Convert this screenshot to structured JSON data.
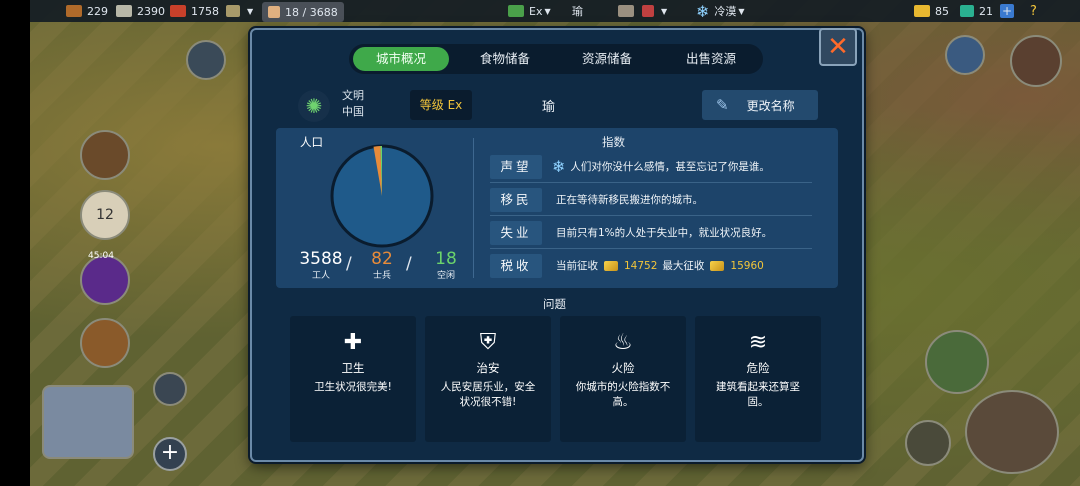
{
  "topbar": {
    "wood": "229",
    "iron": "2390",
    "food": "1758",
    "population": "18 / 3688",
    "era": "Ex",
    "city": "瑜",
    "season": "冷漠",
    "gold": "85",
    "gems": "21",
    "add_label": "+",
    "help_label": "?"
  },
  "tabs": [
    {
      "label": "城市概况",
      "active": true
    },
    {
      "label": "食物储备",
      "active": false
    },
    {
      "label": "资源储备",
      "active": false
    },
    {
      "label": "出售资源",
      "active": false
    }
  ],
  "close_label": "✕",
  "city": {
    "civ_label": "文明",
    "civ_value": "中国",
    "level_label": "等级 Ex",
    "name": "瑜",
    "rename_label": "更改名称"
  },
  "population": {
    "title": "人口",
    "workers": {
      "value": "3588",
      "label": "工人",
      "color": "#ffffff"
    },
    "soldiers": {
      "value": "82",
      "label": "士兵",
      "color": "#e78b3a"
    },
    "idle": {
      "value": "18",
      "label": "空闲",
      "color": "#6bd36b"
    }
  },
  "indices": {
    "title": "指数",
    "rows": [
      {
        "key": "声望",
        "text": "人们对你没什么感情，甚至忘记了你是谁。"
      },
      {
        "key": "移民",
        "text": "正在等待新移民搬进你的城市。"
      },
      {
        "key": "失业",
        "text": "目前只有1%的人处于失业中，就业状况良好。"
      },
      {
        "key": "税收",
        "text": "当前征收",
        "current": "14752",
        "max_label": "最大征收",
        "max": "15960"
      }
    ]
  },
  "issues": {
    "title": "问题",
    "items": [
      {
        "name": "卫生",
        "desc": "卫生状况很完美!",
        "icon": "plus-cross-icon"
      },
      {
        "name": "治安",
        "desc": "人民安居乐业，安全状况很不错!",
        "icon": "shield-icon"
      },
      {
        "name": "火险",
        "desc": "你城市的火险指数不高。",
        "icon": "flame-icon"
      },
      {
        "name": "危险",
        "desc": "建筑看起来还算坚固。",
        "icon": "tornado-icon"
      }
    ]
  },
  "hud": {
    "calendar_day": "12",
    "timer": "45:04",
    "plus_label": "+"
  }
}
